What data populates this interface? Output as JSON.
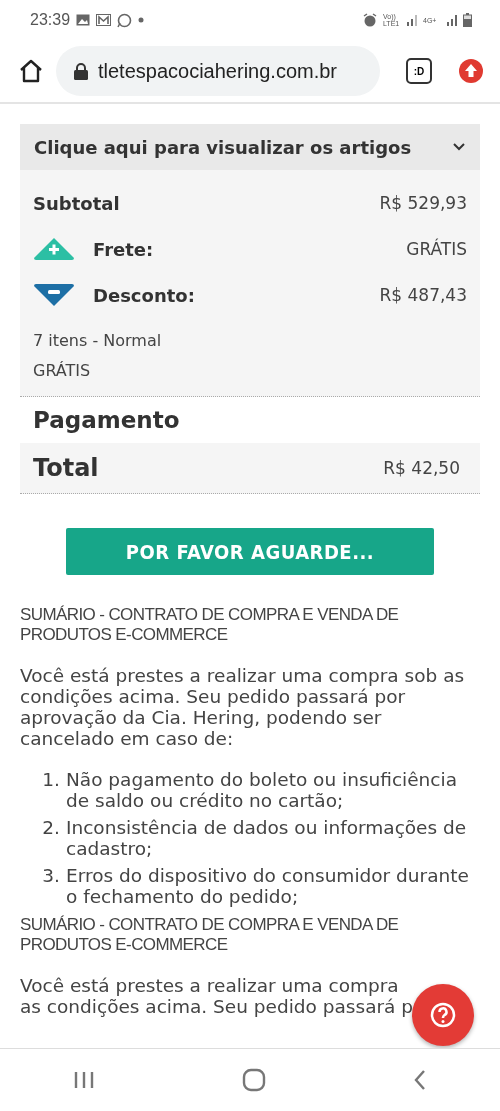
{
  "status_bar": {
    "time": "23:39",
    "network_label": "Vo)) LTE1",
    "network_label_2": "4G+"
  },
  "browser": {
    "url": "tletespacociahering.com.br",
    "tab_badge": ":D"
  },
  "order_summary": {
    "header": {
      "label": "Clique aqui para visualizar os artigos",
      "expanded": false
    },
    "subtotal": {
      "label": "Subtotal",
      "value": "R$ 529,93"
    },
    "lines": [
      {
        "kind": "plus",
        "label": "Frete:",
        "value": "GRÁTIS"
      },
      {
        "kind": "minus",
        "label": "Desconto:",
        "value": "R$ 487,43"
      }
    ],
    "shipping": [
      "7 itens - Normal",
      "GRÁTIS"
    ]
  },
  "payment": {
    "title": "Pagamento",
    "total_label": "Total",
    "total_value": "R$ 42,50"
  },
  "submit_button": {
    "label": "POR FAVOR AGUARDE..."
  },
  "contract": {
    "title": "SUMÁRIO - CONTRATO DE COMPRA E VENDA DE PRODUTOS E-COMMERCE",
    "intro": "Você está prestes a realizar uma compra sob as condições acima. Seu pedido passará por aprovação da Cia. Hering, podendo ser cancelado em caso de:",
    "items": [
      {
        "number": "1.",
        "text": "Não pagamento do boleto ou insuficiência de saldo ou crédito no cartão;"
      },
      {
        "number": "2.",
        "text": "Inconsistência de dados ou informações de cadastro;"
      },
      {
        "number": "3.",
        "text": "Erros do dispositivo do consumidor durante o fechamento do pedido;"
      }
    ]
  },
  "contract_repeat": {
    "title": "SUMÁRIO - CONTRATO DE COMPRA E VENDA DE PRODUTOS E-COMMERCE",
    "intro_lines": [
      "Você está prestes a realizar uma compra",
      "as condições acima. Seu pedido passará p"
    ]
  }
}
